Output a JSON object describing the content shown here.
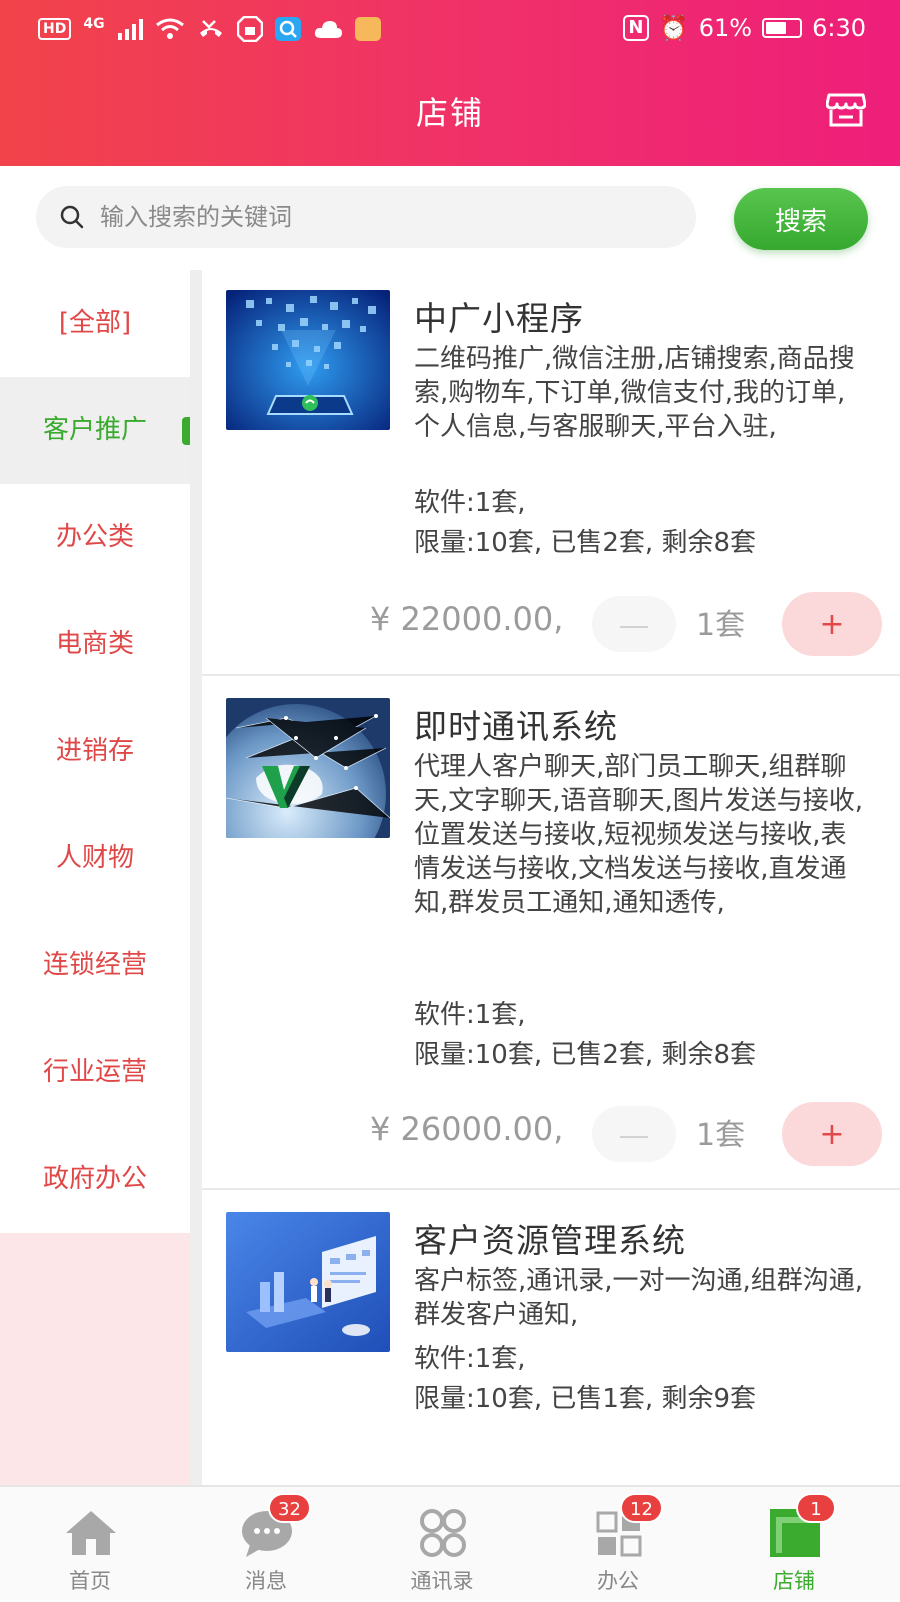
{
  "status_bar": {
    "left_icons": [
      "HD",
      "4G",
      "signal-icon",
      "wifi-icon",
      "missed-call-icon",
      "vpn-icon",
      "search-app-icon",
      "cloud-icon",
      "notification-app-icon"
    ],
    "nfc": "N",
    "alarm": "⏰",
    "battery": "61%",
    "battery_level": 0.61,
    "time": "6:30"
  },
  "header": {
    "title": "店铺",
    "right_icon": "shop-icon"
  },
  "search": {
    "placeholder": "输入搜索的关键词",
    "value": "",
    "button_label": "搜索"
  },
  "sidebar": {
    "items": [
      {
        "label": "[全部]",
        "active": false
      },
      {
        "label": "客户推广",
        "active": true
      },
      {
        "label": "办公类",
        "active": false
      },
      {
        "label": "电商类",
        "active": false
      },
      {
        "label": "进销存",
        "active": false
      },
      {
        "label": "人财物",
        "active": false
      },
      {
        "label": "连锁经营",
        "active": false
      },
      {
        "label": "行业运营",
        "active": false
      },
      {
        "label": "政府办公",
        "active": false
      }
    ]
  },
  "products": [
    {
      "title": "中广小程序",
      "description": "二维码推广,微信注册,店铺搜索,商品搜索,购物车,下订单,微信支付,我的订单,个人信息,与客服聊天,平台入驻,",
      "software": "软件:1套,",
      "limit": "限量:10套, 已售2套, 剩余8套",
      "price": "¥ 22000.00,",
      "minus": "—",
      "qty": "1套",
      "plus": "+"
    },
    {
      "title": "即时通讯系统",
      "description": "代理人客户聊天,部门员工聊天,组群聊天,文字聊天,语音聊天,图片发送与接收,位置发送与接收,短视频发送与接收,表情发送与接收,文档发送与接收,直发通知,群发员工通知,通知透传,",
      "software": "软件:1套,",
      "limit": "限量:10套, 已售2套, 剩余8套",
      "price": "¥ 26000.00,",
      "minus": "—",
      "qty": "1套",
      "plus": "+"
    },
    {
      "title": "客户资源管理系统",
      "description": "客户标签,通讯录,一对一沟通,组群沟通,群发客户通知,",
      "software": "软件:1套,",
      "limit": "限量:10套, 已售1套, 剩余9套"
    }
  ],
  "tabbar": {
    "items": [
      {
        "label": "首页",
        "icon": "home-icon",
        "badge": ""
      },
      {
        "label": "消息",
        "icon": "chat-icon",
        "badge": "32"
      },
      {
        "label": "通讯录",
        "icon": "contacts-icon",
        "badge": ""
      },
      {
        "label": "办公",
        "icon": "office-grid-icon",
        "badge": "12"
      },
      {
        "label": "店铺",
        "icon": "shop-tab-icon",
        "badge": "1"
      }
    ]
  },
  "colors": {
    "header_start": "#f2434a",
    "header_end": "#ee1e7a",
    "accent_green": "#3aab2f",
    "category_red": "#e04848",
    "badge_red": "#e8403e"
  }
}
